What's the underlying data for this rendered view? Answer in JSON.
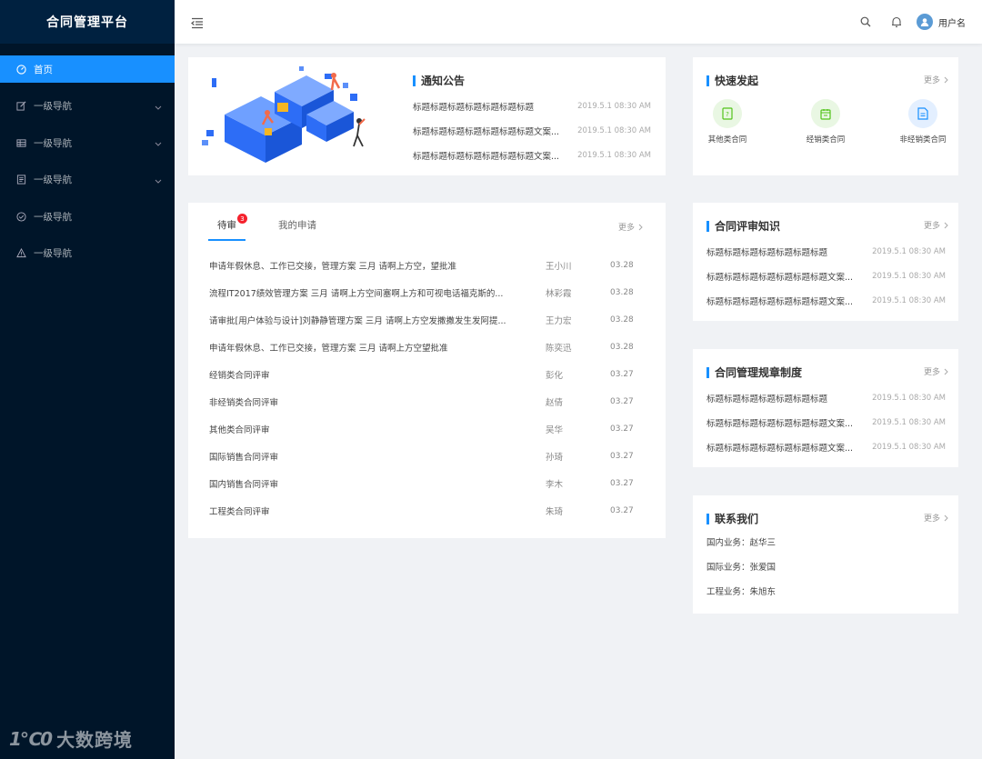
{
  "app": {
    "title": "合同管理平台",
    "brand_mark": "1℃0",
    "brand_text": "大数跨境"
  },
  "sidebar": {
    "items": [
      {
        "label": "首页",
        "icon": "dashboard-icon",
        "active": true
      },
      {
        "label": "一级导航",
        "icon": "edit-icon",
        "expandable": true
      },
      {
        "label": "一级导航",
        "icon": "table-icon",
        "expandable": true
      },
      {
        "label": "一级导航",
        "icon": "form-icon",
        "expandable": true
      },
      {
        "label": "一级导航",
        "icon": "check-circle-icon",
        "expandable": false
      },
      {
        "label": "一级导航",
        "icon": "warning-icon",
        "expandable": false
      }
    ]
  },
  "header": {
    "username": "用户名"
  },
  "notice": {
    "title": "通知公告",
    "rows": [
      {
        "title": "标题标题标题标题标题标题标题",
        "date": "2019.5.1  08:30 AM"
      },
      {
        "title": "标题标题标题标题标题标题标题文案...",
        "date": "2019.5.1  08:30 AM"
      },
      {
        "title": "标题标题标题标题标题标题标题文案...",
        "date": "2019.5.1  08:30 AM"
      }
    ]
  },
  "pending": {
    "tabs": [
      {
        "label": "待审",
        "badge": "3"
      },
      {
        "label": "我的申请"
      }
    ],
    "more": "更多",
    "rows": [
      {
        "title": "申请年假休息、工作已交接，管理方案 三月 请啊上方空，望批准",
        "person": "王小川",
        "date": "03.28"
      },
      {
        "title": "流程IT2017绩效管理方案 三月 请啊上方空间塞啊上方和可视电话福克斯的...",
        "person": "林彩霞",
        "date": "03.28"
      },
      {
        "title": "请审批[用户体验与设计]刘静静管理方案 三月 请啊上方空发撒撒发生发阿提...",
        "person": "王力宏",
        "date": "03.28"
      },
      {
        "title": "申请年假休息、工作已交接，管理方案 三月 请啊上方空望批准",
        "person": "陈奕迅",
        "date": "03.28"
      },
      {
        "title": "经销类合同评审",
        "person": "彭化",
        "date": "03.27"
      },
      {
        "title": "非经销类合同评审",
        "person": "赵倩",
        "date": "03.27"
      },
      {
        "title": "其他类合同评审",
        "person": "吴华",
        "date": "03.27"
      },
      {
        "title": "国际销售合同评审",
        "person": "孙琦",
        "date": "03.27"
      },
      {
        "title": "国内销售合同评审",
        "person": "李木",
        "date": "03.27"
      },
      {
        "title": "工程类合同评审",
        "person": "朱琦",
        "date": "03.27"
      }
    ]
  },
  "quick": {
    "title": "快速发起",
    "more": "更多",
    "items": [
      {
        "label": "其他类合同",
        "color": "#52c41a",
        "bg": "#e9f7e3"
      },
      {
        "label": "经销类合同",
        "color": "#52c41a",
        "bg": "#e9f7e3"
      },
      {
        "label": "非经销类合同",
        "color": "#1890ff",
        "bg": "#e3efff"
      }
    ]
  },
  "knowledge": {
    "title": "合同评审知识",
    "more": "更多",
    "rows": [
      {
        "title": "标题标题标题标题标题标题标题",
        "date": "2019.5.1  08:30 AM"
      },
      {
        "title": "标题标题标题标题标题标题标题文案...",
        "date": "2019.5.1  08:30 AM"
      },
      {
        "title": "标题标题标题标题标题标题标题文案...",
        "date": "2019.5.1  08:30 AM"
      }
    ]
  },
  "rules": {
    "title": "合同管理规章制度",
    "more": "更多",
    "rows": [
      {
        "title": "标题标题标题标题标题标题标题",
        "date": "2019.5.1  08:30 AM"
      },
      {
        "title": "标题标题标题标题标题标题标题文案...",
        "date": "2019.5.1  08:30 AM"
      },
      {
        "title": "标题标题标题标题标题标题标题文案...",
        "date": "2019.5.1  08:30 AM"
      }
    ]
  },
  "contact": {
    "title": "联系我们",
    "more": "更多",
    "rows": [
      "国内业务：赵华三",
      "国际业务：张爱国",
      "工程业务：朱旭东"
    ]
  },
  "colors": {
    "primary": "#1890ff",
    "sidebar": "#001529",
    "badge": "#f5222d"
  }
}
